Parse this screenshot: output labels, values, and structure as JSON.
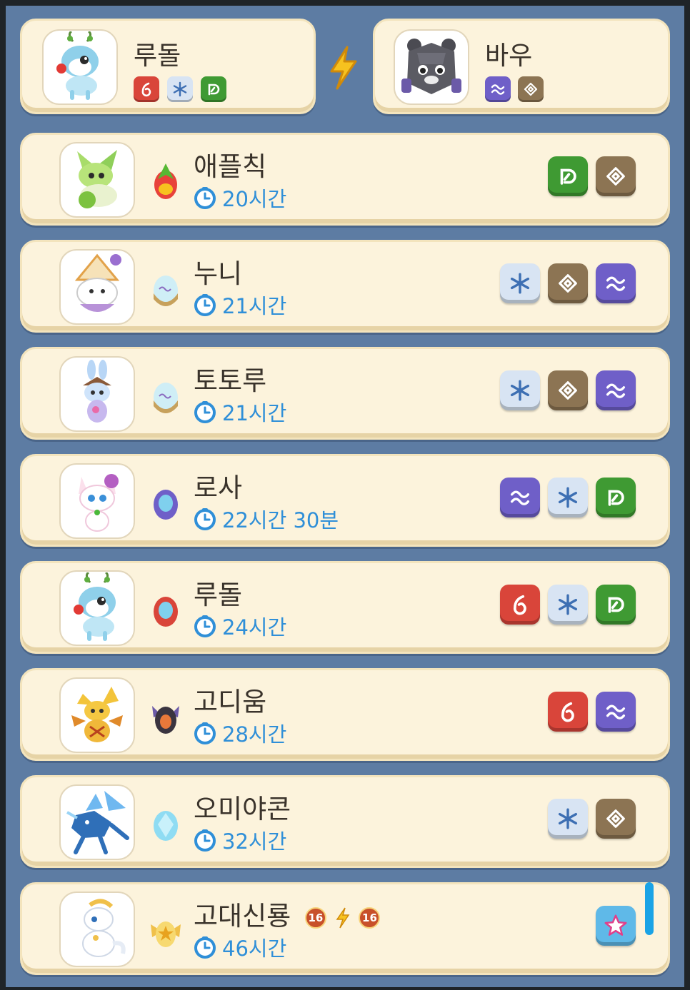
{
  "parents": [
    {
      "name": "루돌",
      "portrait": "rudol-deer-portrait",
      "types": [
        "fire",
        "ice",
        "leaf"
      ]
    },
    {
      "name": "바우",
      "portrait": "bau-rock-bear-portrait",
      "types": [
        "wind",
        "earth"
      ]
    }
  ],
  "combine_icon": "lightning-icon",
  "results": [
    {
      "name": "애플칙",
      "time": "20시간",
      "egg": "green-egg",
      "types": [
        "leaf",
        "earth"
      ]
    },
    {
      "name": "누니",
      "time": "21시간",
      "egg": "ice-wind-egg",
      "types": [
        "ice",
        "earth",
        "wind"
      ]
    },
    {
      "name": "토토루",
      "time": "21시간",
      "egg": "ice-wind-egg",
      "types": [
        "ice",
        "earth",
        "wind"
      ]
    },
    {
      "name": "로사",
      "time": "22시간 30분",
      "egg": "purple-egg",
      "types": [
        "wind",
        "ice",
        "leaf"
      ]
    },
    {
      "name": "루돌",
      "time": "24시간",
      "egg": "red-egg",
      "types": [
        "fire",
        "ice",
        "leaf"
      ]
    },
    {
      "name": "고디움",
      "time": "28시간",
      "egg": "dark-winged-egg",
      "types": [
        "fire",
        "wind"
      ]
    },
    {
      "name": "오미야콘",
      "time": "32시간",
      "egg": "crystal-egg",
      "types": [
        "ice",
        "earth"
      ]
    },
    {
      "name": "고대신룡",
      "time": "46시간",
      "egg": "golden-winged-egg",
      "types": [
        "star"
      ],
      "badges": [
        "16",
        "16"
      ]
    }
  ],
  "colors": {
    "background": "#5d7ca3",
    "card": "#fcf3dc",
    "time_text": "#2f8fd8",
    "fire": "#d9453a",
    "ice": "#d8e4f3",
    "leaf": "#3f9a33",
    "earth": "#8c7453",
    "wind": "#6f5fc8",
    "star": "#5fb9e8"
  }
}
